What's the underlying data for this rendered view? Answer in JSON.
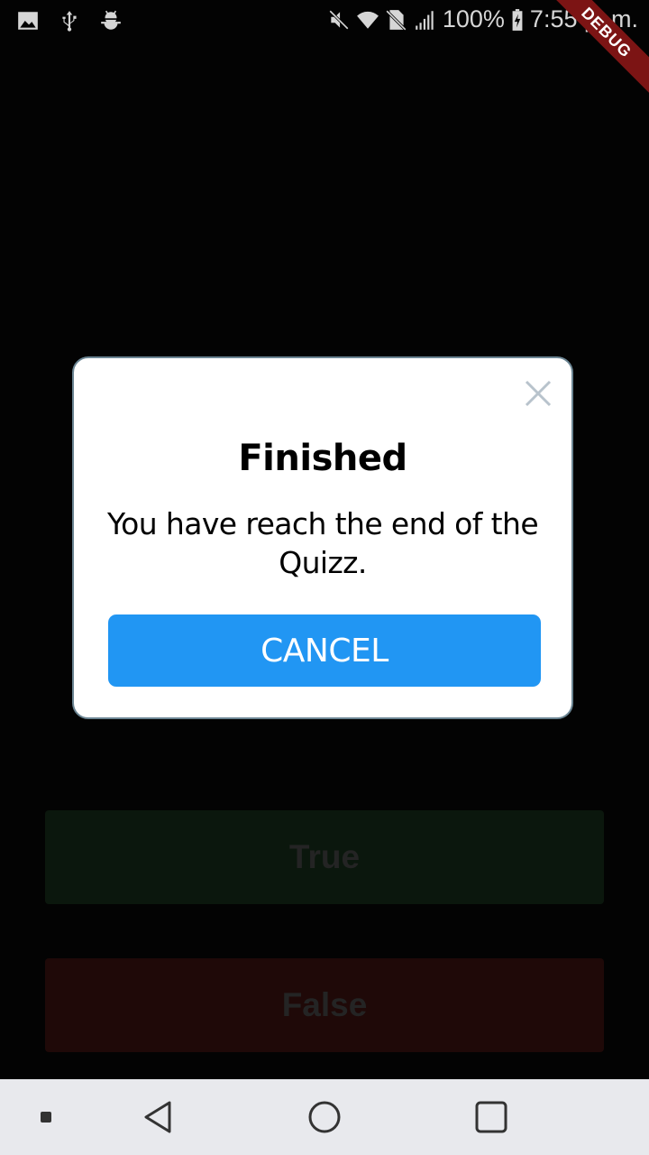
{
  "status_bar": {
    "left_icons": [
      "image-icon",
      "usb-icon",
      "android-debug-icon"
    ],
    "right_icons": [
      "mute-icon",
      "wifi-icon",
      "no-sim-icon",
      "signal-icon"
    ],
    "battery_percent": "100%",
    "time": "7:55 p. m."
  },
  "debug_banner": {
    "label": "DEBUG",
    "color": "#7c1414"
  },
  "dialog": {
    "title": "Finished",
    "message": "You have reach the end of the Quizz.",
    "cancel_label": "CANCEL",
    "accent_color": "#2196f3"
  },
  "quiz": {
    "true_label": "True",
    "false_label": "False",
    "true_color": "#0b170d",
    "false_color": "#1f0908"
  },
  "nav_bar": {
    "items": [
      "notification-dot",
      "back",
      "home",
      "recents"
    ]
  }
}
